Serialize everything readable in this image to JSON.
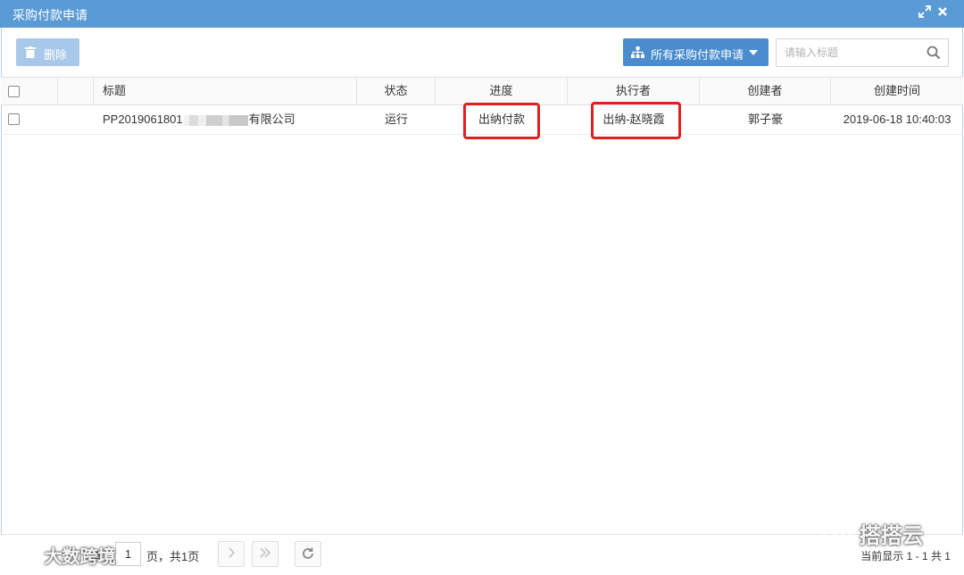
{
  "window": {
    "title": "采购付款申请"
  },
  "toolbar": {
    "delete_label": "删除",
    "filter_label": "所有采购付款申请",
    "search_placeholder": "请输入标题"
  },
  "table": {
    "headers": [
      "标题",
      "状态",
      "进度",
      "执行者",
      "创建者",
      "创建时间"
    ],
    "rows": [
      {
        "title_prefix": "PP2019061801",
        "title_suffix": "有限公司",
        "status": "运行",
        "progress": "出纳付款",
        "executor": "出纳-赵晓霞",
        "creator": "郭子豪",
        "created": "2019-06-18 10:40:03"
      }
    ]
  },
  "pager": {
    "prefix": "第",
    "page": "1",
    "suffix": "页，共1页",
    "info": "当前显示 1 - 1 共 1"
  },
  "watermarks": {
    "left": "大数跨境",
    "right": "搭搭云"
  },
  "colors": {
    "titlebar": "#5b9bd5",
    "primary_button": "#4a8ccd",
    "disabled_button": "#a8c8ea",
    "highlight_box": "#e02020"
  }
}
